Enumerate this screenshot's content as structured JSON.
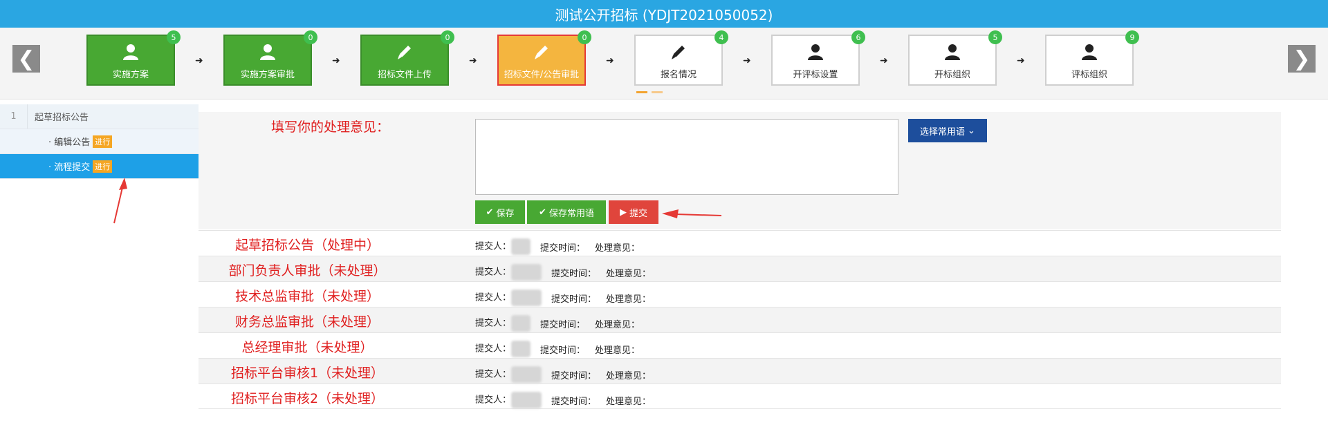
{
  "title": "测试公开招标 (YDJT2021050052)",
  "nav": {
    "prev": "❮",
    "next": "❯"
  },
  "steps": [
    {
      "label": "实施方案",
      "badge": "5",
      "icon": "user-icon"
    },
    {
      "label": "实施方案审批",
      "badge": "0",
      "icon": "user-icon"
    },
    {
      "label": "招标文件上传",
      "badge": "0",
      "icon": "pencil-icon"
    },
    {
      "label": "招标文件/公告审批",
      "badge": "0",
      "icon": "pencil-icon"
    },
    {
      "label": "报名情况",
      "badge": "4",
      "icon": "pencil-icon"
    },
    {
      "label": "开评标设置",
      "badge": "6",
      "icon": "user-icon"
    },
    {
      "label": "开标组织",
      "badge": "5",
      "icon": "user-icon"
    },
    {
      "label": "评标组织",
      "badge": "9",
      "icon": "user-icon"
    }
  ],
  "sidebar": {
    "group_num": "1",
    "group_title": "起草招标公告",
    "items": [
      {
        "label": "· 编辑公告",
        "tag": "进行"
      },
      {
        "label": "· 流程提交",
        "tag": "进行"
      }
    ]
  },
  "form": {
    "label": "填写你的处理意见：",
    "textarea_value": "",
    "save": "保存",
    "save_common": "保存常用语",
    "submit": "提交",
    "choose_phrase": "选择常用语"
  },
  "meta_labels": {
    "submitter": "提交人：",
    "time": "提交时间：",
    "opinion": "处理意见："
  },
  "records": [
    "起草招标公告（处理中）",
    "部门负责人审批（未处理）",
    "技术总监审批（未处理）",
    "财务总监审批（未处理）",
    "总经理审批（未处理）",
    "招标平台审核1（未处理）",
    "招标平台审核2（未处理）"
  ],
  "colors": {
    "titlebar": "#2aa6e2",
    "step_done": "#48a833",
    "step_active": "#f4b53f",
    "badge": "#3fbf4f",
    "submit": "#e0453c",
    "phrase_button": "#1d4e9c",
    "sidebar_selected": "#1ea0e7",
    "record_title": "#e02020"
  }
}
